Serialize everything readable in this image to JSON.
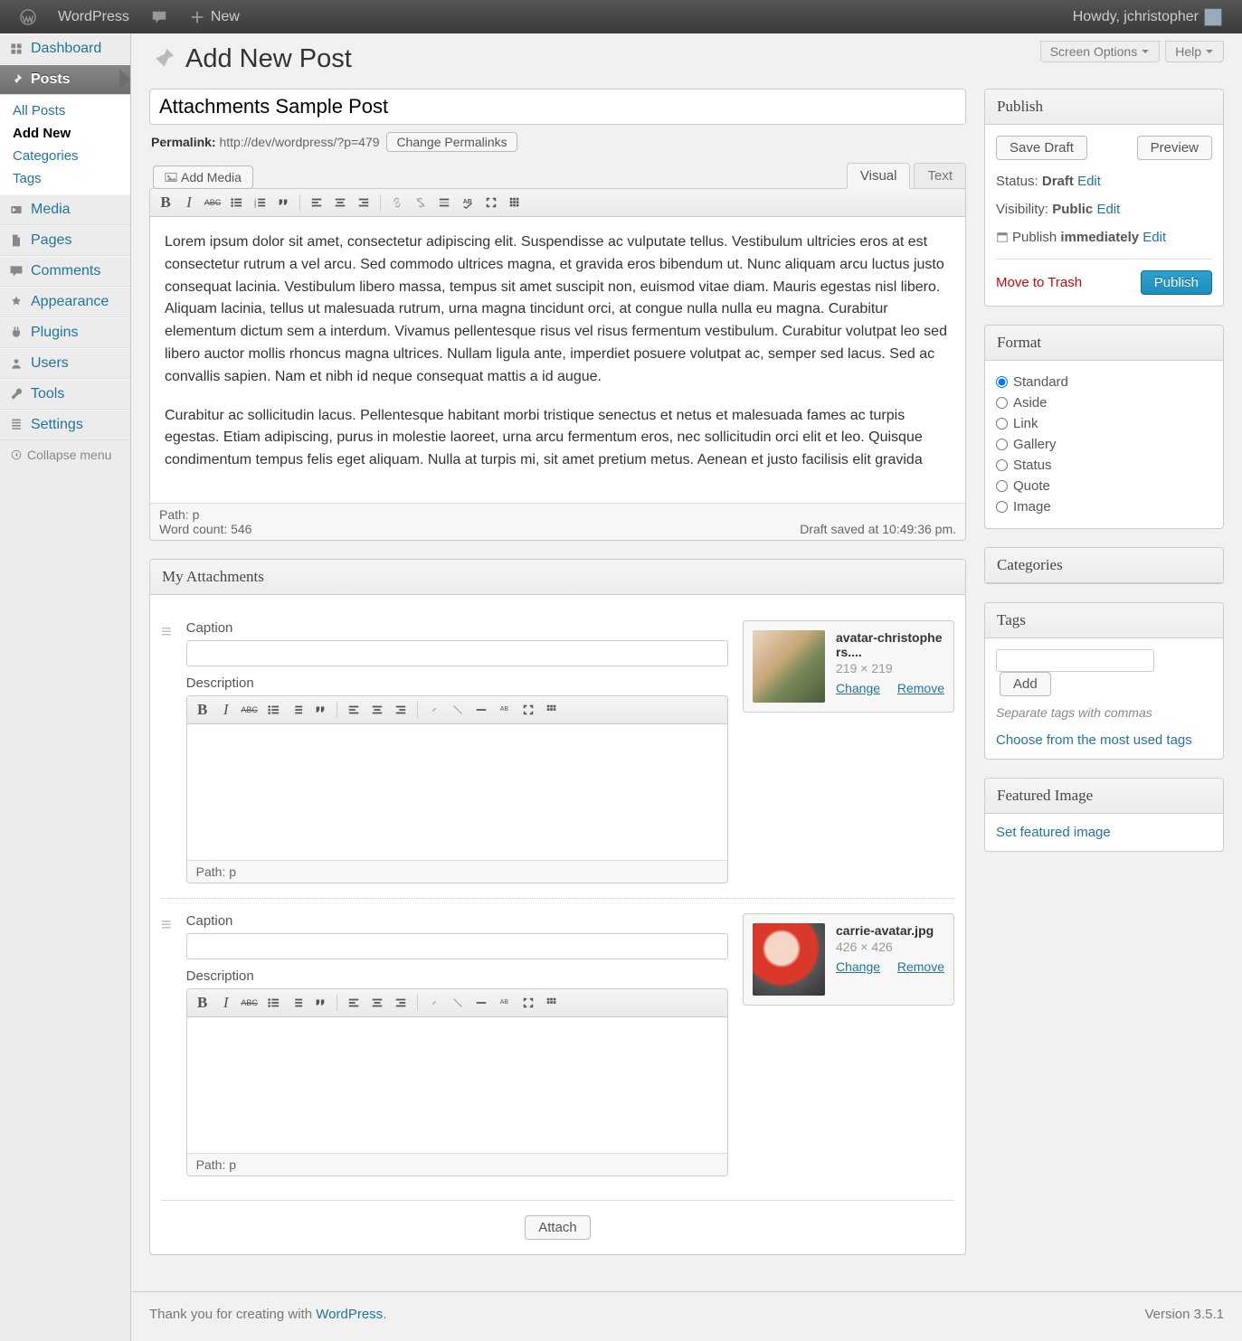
{
  "adminbar": {
    "site": "WordPress",
    "new": "New",
    "howdy": "Howdy, jchristopher"
  },
  "menu": {
    "dashboard": "Dashboard",
    "posts": "Posts",
    "posts_sub": {
      "all": "All Posts",
      "add": "Add New",
      "cats": "Categories",
      "tags": "Tags"
    },
    "media": "Media",
    "pages": "Pages",
    "comments": "Comments",
    "appearance": "Appearance",
    "plugins": "Plugins",
    "users": "Users",
    "tools": "Tools",
    "settings": "Settings",
    "collapse": "Collapse menu"
  },
  "screen": {
    "options": "Screen Options",
    "help": "Help"
  },
  "page_title": "Add New Post",
  "title_value": "Attachments Sample Post",
  "permalink": {
    "label": "Permalink:",
    "url": "http://dev/wordpress/?p=479",
    "change": "Change Permalinks"
  },
  "add_media": "Add Media",
  "tabs": {
    "visual": "Visual",
    "text": "Text"
  },
  "content": {
    "p1": "Lorem ipsum dolor sit amet, consectetur adipiscing elit. Suspendisse ac vulputate tellus. Vestibulum ultricies eros at est consectetur rutrum a vel arcu. Sed commodo ultrices magna, et gravida eros bibendum ut. Nunc aliquam arcu luctus justo consequat lacinia. Vestibulum libero massa, tempus sit amet suscipit non, euismod vitae diam. Mauris egestas nisl libero. Aliquam lacinia, tellus ut malesuada rutrum, urna magna tincidunt orci, at congue nulla nulla eu magna. Curabitur elementum dictum sem a interdum. Vivamus pellentesque risus vel risus fermentum vestibulum. Curabitur volutpat leo sed libero auctor mollis rhoncus magna ultrices. Nullam ligula ante, imperdiet posuere volutpat ac, semper sed lacus. Sed ac convallis sapien. Nam et nibh id neque consequat mattis a id augue.",
    "p2": "Curabitur ac sollicitudin lacus. Pellentesque habitant morbi tristique senectus et netus et malesuada fames ac turpis egestas. Etiam adipiscing, purus in molestie laoreet, urna arcu fermentum eros, nec sollicitudin orci elit et leo. Quisque condimentum tempus felis eget aliquam. Nulla at turpis mi, sit amet pretium metus. Aenean et justo facilisis elit gravida"
  },
  "editor_status": {
    "path": "Path: p",
    "wordcount": "Word count: 546",
    "saved": "Draft saved at 10:49:36 pm."
  },
  "publish": {
    "title": "Publish",
    "save_draft": "Save Draft",
    "preview": "Preview",
    "status_label": "Status:",
    "status_value": "Draft",
    "vis_label": "Visibility:",
    "vis_value": "Public",
    "pub_label": "Publish",
    "pub_value": "immediately",
    "edit": "Edit",
    "trash": "Move to Trash",
    "publish_btn": "Publish"
  },
  "format": {
    "title": "Format",
    "options": [
      "Standard",
      "Aside",
      "Link",
      "Gallery",
      "Status",
      "Quote",
      "Image"
    ]
  },
  "categories": {
    "title": "Categories"
  },
  "tags": {
    "title": "Tags",
    "add": "Add",
    "hint": "Separate tags with commas",
    "choose": "Choose from the most used tags"
  },
  "featured": {
    "title": "Featured Image",
    "set": "Set featured image"
  },
  "attachments": {
    "title": "My Attachments",
    "caption": "Caption",
    "description": "Description",
    "path": "Path: p",
    "attach_btn": "Attach",
    "items": [
      {
        "file": "avatar-christophers....",
        "dim": "219 × 219",
        "change": "Change",
        "remove": "Remove"
      },
      {
        "file": "carrie-avatar.jpg",
        "dim": "426 × 426",
        "change": "Change",
        "remove": "Remove"
      }
    ]
  },
  "footer": {
    "thanks": "Thank you for creating with ",
    "wp": "WordPress",
    "dot": ".",
    "version": "Version 3.5.1"
  }
}
